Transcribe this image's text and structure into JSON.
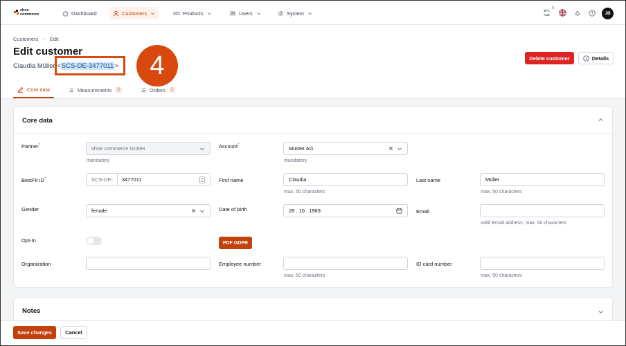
{
  "colors": {
    "accent": "#c2410c",
    "danger": "#dc2626",
    "annotation": "#d9480f"
  },
  "logo": {
    "line1": "shoe",
    "line2": "commerce"
  },
  "nav": {
    "items": [
      {
        "label": "Dashboard",
        "icon": "home-icon"
      },
      {
        "label": "Customers",
        "icon": "user-icon",
        "active": true
      },
      {
        "label": "Products",
        "icon": "ruler-icon"
      },
      {
        "label": "Users",
        "icon": "users-icon"
      },
      {
        "label": "System",
        "icon": "gear-icon"
      }
    ],
    "sync_badge": "0",
    "avatar": "JB"
  },
  "breadcrumb": {
    "items": [
      "Customers",
      "Edit"
    ]
  },
  "page": {
    "title": "Edit customer",
    "subtitle_name": "Claudia Müller",
    "subtitle_open": " <",
    "subtitle_id": "SCS-DE-3477011",
    "subtitle_close": ">"
  },
  "annotation": {
    "number": "4"
  },
  "actions": {
    "delete": "Delete customer",
    "details": "Details"
  },
  "tabs": [
    {
      "label": "Core data",
      "active": true
    },
    {
      "label": "Measurements",
      "count": "2"
    },
    {
      "label": "Orders",
      "count": "1"
    }
  ],
  "core": {
    "title": "Core data",
    "partner": {
      "label": "Partner",
      "value": "shoe commerce GmbH",
      "hint": "mandatory"
    },
    "account": {
      "label": "Account",
      "value": "Muster AG",
      "hint": "mandatory"
    },
    "bestfit": {
      "label": "BestFit ID",
      "prefix": "SCS-DE-",
      "value": "3477011"
    },
    "first_name": {
      "label": "First name",
      "value": "Claudia",
      "hint": "max. 50 characters"
    },
    "last_name": {
      "label": "Last name",
      "value": "Müller",
      "hint": "max. 50 characters"
    },
    "gender": {
      "label": "Gender",
      "value": "female"
    },
    "dob": {
      "label": "Date of birth",
      "value": "28 . 10 . 1969"
    },
    "email": {
      "label": "Email",
      "value": "",
      "hint": "valid Email address; max. 50 characters"
    },
    "optin": {
      "label": "Opt-In",
      "on": false
    },
    "pdf_button": "PDF GDPR",
    "organization": {
      "label": "Organization",
      "value": ""
    },
    "employee": {
      "label": "Employee number",
      "value": "",
      "hint": "max. 50 characters"
    },
    "idcard": {
      "label": "ID card number",
      "value": "",
      "hint": "max. 50 characters"
    }
  },
  "notes": {
    "title": "Notes"
  },
  "footer": {
    "save": "Save changes",
    "cancel": "Cancel"
  }
}
